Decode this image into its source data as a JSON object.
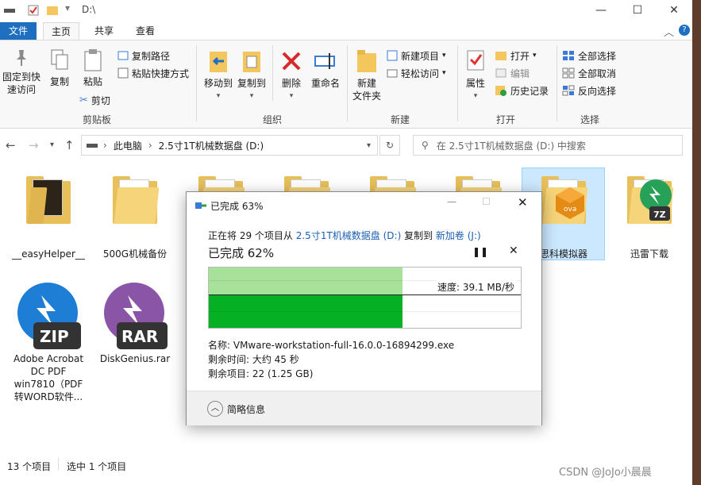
{
  "window": {
    "path_title": "D:\\",
    "controls": {
      "minimize": "—",
      "maximize": "☐",
      "close": "✕"
    }
  },
  "ribbon_tabs": [
    "文件",
    "主页",
    "共享",
    "查看"
  ],
  "ribbon": {
    "pin_label_1": "固定到快",
    "pin_label_2": "速访问",
    "copy": "复制",
    "paste": "粘贴",
    "copy_path": "复制路径",
    "paste_shortcut": "粘贴快捷方式",
    "cut": "剪切",
    "clipboard_group": "剪贴板",
    "move_to": "移动到",
    "copy_to": "复制到",
    "delete": "删除",
    "rename": "重命名",
    "organize_group": "组织",
    "new_folder_1": "新建",
    "new_folder_2": "文件夹",
    "new_item": "新建项目",
    "easy_access": "轻松访问",
    "new_group": "新建",
    "properties": "属性",
    "open": "打开",
    "edit": "编辑",
    "history": "历史记录",
    "open_group": "打开",
    "select_all": "全部选择",
    "select_none": "全部取消",
    "invert_selection": "反向选择",
    "select_group": "选择"
  },
  "address": {
    "crumbs": [
      "此电脑",
      "2.5寸1T机械数据盘 (D:)"
    ],
    "search_placeholder": "在 2.5寸1T机械数据盘 (D:) 中搜索"
  },
  "files": [
    {
      "name": "__easyHelper__",
      "type": "folder-dark"
    },
    {
      "name": "500G机械备份",
      "type": "folder"
    },
    {
      "name": "",
      "type": "folder"
    },
    {
      "name": "",
      "type": "folder"
    },
    {
      "name": "",
      "type": "folder"
    },
    {
      "name": "",
      "type": "folder"
    },
    {
      "name": "思科模拟器",
      "type": "folder-ova"
    },
    {
      "name": "迅雷下载",
      "type": "folder-7z"
    },
    {
      "name": "Adobe Acrobat DC PDF win7810（PDF转WORD软件...",
      "type": "zip",
      "lines": [
        "Adobe Acrobat",
        "DC PDF",
        "win7810（PDF",
        "转WORD软件..."
      ]
    },
    {
      "name": "DiskGenius.rar",
      "type": "rar"
    }
  ],
  "status": {
    "items": "13 个项目",
    "selected": "选中 1 个项目"
  },
  "dialog": {
    "title": "已完成 63%",
    "copy_prefix": "正在将 29 个项目从",
    "source": "2.5寸1T机械数据盘 (D:)",
    "copy_mid": "复制到",
    "dest": "新加卷 (J:)",
    "progress_label": "已完成 62%",
    "progress": 0.62,
    "speed": "速度: 39.1 MB/秒",
    "file_name": "名称: VMware-workstation-full-16.0.0-16894299.exe",
    "time_left": "剩余时间: 大约 45 秒",
    "items_left": "剩余项目: 22 (1.25 GB)",
    "details": "简略信息"
  },
  "watermark": "CSDN @JoJo小晨晨",
  "colors": {
    "accent": "#1e6fbf",
    "progress_fill": "#06b025",
    "progress_light": "#a8e29a",
    "folder": "#e8bf58"
  }
}
